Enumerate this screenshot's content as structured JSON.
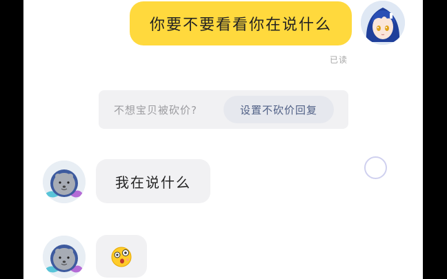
{
  "messages": {
    "sent": {
      "text": "你要不要看看你在说什么",
      "read_status": "已读"
    },
    "notice": {
      "text": "不想宝贝被砍价?",
      "action_label": "设置不砍价回复"
    },
    "received": [
      {
        "text": "我在说什么"
      },
      {
        "emoji": "surprised-face-sticker"
      }
    ]
  }
}
